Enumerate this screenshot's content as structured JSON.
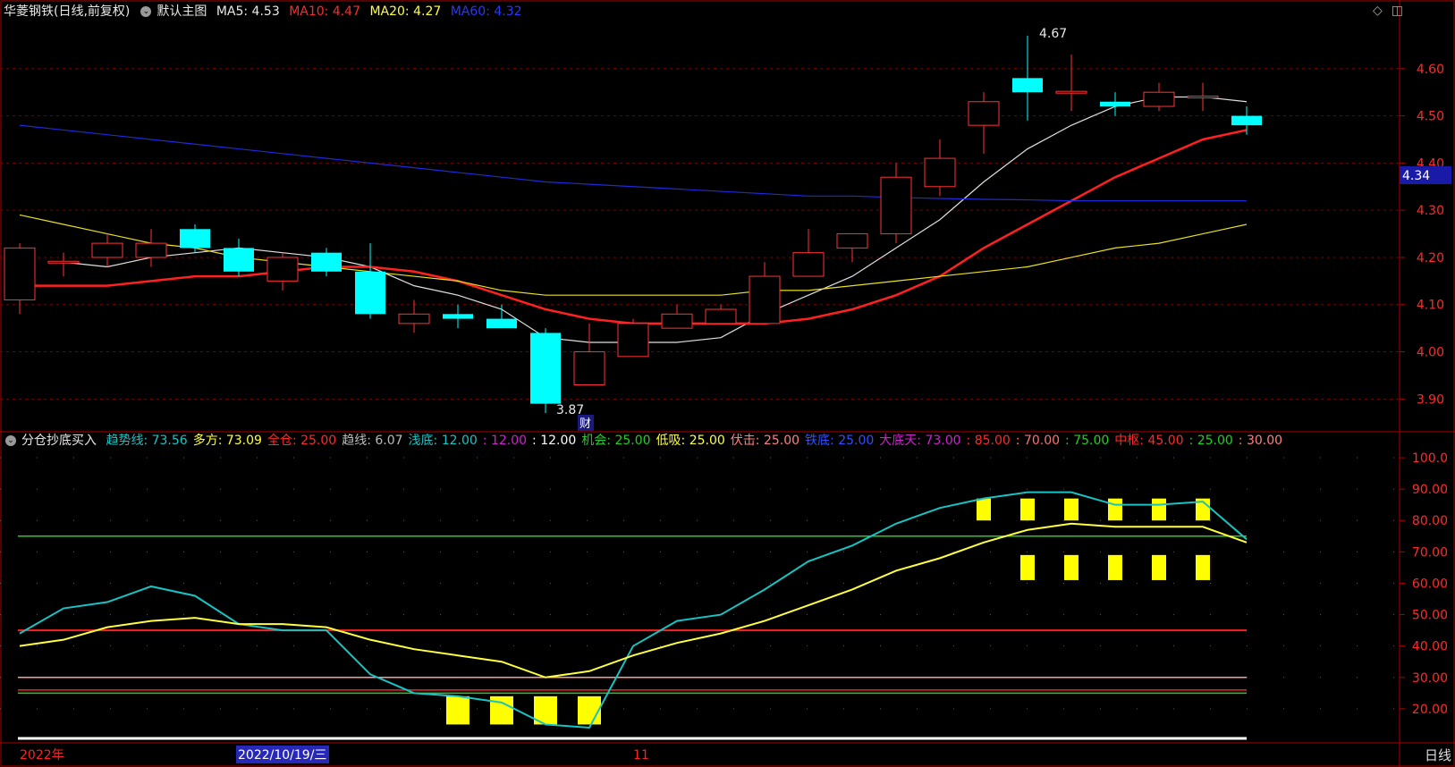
{
  "main_header": {
    "title": "华菱钢铁(日线,前复权)",
    "mode": "默认主图",
    "ma5": "MA5: 4.53",
    "ma10": "MA10: 4.47",
    "ma20": "MA20: 4.27",
    "ma60": "MA60: 4.32"
  },
  "indicator_header": {
    "name": "分仓抄底买入",
    "items": [
      {
        "text": "趋势线: 73.56",
        "color": "#19c3c3"
      },
      {
        "text": "多方: 73.09",
        "color": "#ffff40"
      },
      {
        "text": "全仓: 25.00",
        "color": "#ff2a2a"
      },
      {
        "text": "趋线: 6.07",
        "color": "#bbbbbb"
      },
      {
        "text": "浅底: 12.00",
        "color": "#19c3c3"
      },
      {
        "text": ": 12.00",
        "color": "#d020d0"
      },
      {
        "text": ": 12.00",
        "color": "#ffffff"
      },
      {
        "text": "机会: 25.00",
        "color": "#20d020"
      },
      {
        "text": "低吸: 25.00",
        "color": "#ffff40"
      },
      {
        "text": "伏击: 25.00",
        "color": "#ff8080"
      },
      {
        "text": "铁底: 25.00",
        "color": "#3050ff"
      },
      {
        "text": "大底天: 73.00",
        "color": "#d020d0"
      },
      {
        "text": ": 85.00",
        "color": "#ff2a2a"
      },
      {
        "text": ": 70.00",
        "color": "#ff7070"
      },
      {
        "text": ": 75.00",
        "color": "#20d020"
      },
      {
        "text": "中枢: 45.00",
        "color": "#ff2a2a"
      },
      {
        "text": ": 25.00",
        "color": "#20d020"
      },
      {
        "text": ": 30.00",
        "color": "#ff8080"
      }
    ]
  },
  "annotations": {
    "high": "4.67",
    "low": "3.87",
    "cai": "财"
  },
  "price_axis": {
    "labels": [
      "4.60",
      "4.50",
      "4.40",
      "4.30",
      "4.20",
      "4.10",
      "4.00",
      "3.90"
    ],
    "current": "4.34"
  },
  "indicator_axis": {
    "labels": [
      "100.0",
      "90.00",
      "80.00",
      "70.00",
      "60.00",
      "50.00",
      "40.00",
      "30.00",
      "20.00"
    ]
  },
  "bottom_axis": {
    "year": "2022年",
    "cursor_date": "2022/10/19/三",
    "month": "11",
    "timeframe": "日线"
  },
  "colors": {
    "up": "#ff3232",
    "down": "#00ffff",
    "grid": "#7a0000",
    "axis": "#b00000"
  },
  "chart_data": [
    {
      "type": "candlestick",
      "ylim": [
        3.84,
        4.7
      ],
      "candles": [
        {
          "o": 4.11,
          "h": 4.23,
          "l": 4.08,
          "c": 4.22
        },
        {
          "o": 4.19,
          "h": 4.21,
          "l": 4.16,
          "c": 4.19
        },
        {
          "o": 4.2,
          "h": 4.25,
          "l": 4.18,
          "c": 4.23
        },
        {
          "o": 4.2,
          "h": 4.26,
          "l": 4.18,
          "c": 4.23
        },
        {
          "o": 4.26,
          "h": 4.27,
          "l": 4.21,
          "c": 4.22
        },
        {
          "o": 4.22,
          "h": 4.24,
          "l": 4.16,
          "c": 4.17
        },
        {
          "o": 4.15,
          "h": 4.21,
          "l": 4.13,
          "c": 4.2
        },
        {
          "o": 4.21,
          "h": 4.22,
          "l": 4.16,
          "c": 4.17
        },
        {
          "o": 4.17,
          "h": 4.23,
          "l": 4.07,
          "c": 4.08
        },
        {
          "o": 4.06,
          "h": 4.11,
          "l": 4.04,
          "c": 4.08
        },
        {
          "o": 4.08,
          "h": 4.1,
          "l": 4.05,
          "c": 4.07
        },
        {
          "o": 4.07,
          "h": 4.1,
          "l": 4.05,
          "c": 4.05
        },
        {
          "o": 4.04,
          "h": 4.05,
          "l": 3.87,
          "c": 3.89
        },
        {
          "o": 3.93,
          "h": 4.06,
          "l": 3.93,
          "c": 4.0
        },
        {
          "o": 3.99,
          "h": 4.07,
          "l": 3.99,
          "c": 4.06
        },
        {
          "o": 4.05,
          "h": 4.1,
          "l": 4.05,
          "c": 4.08
        },
        {
          "o": 4.06,
          "h": 4.1,
          "l": 4.06,
          "c": 4.09
        },
        {
          "o": 4.06,
          "h": 4.19,
          "l": 4.06,
          "c": 4.16
        },
        {
          "o": 4.16,
          "h": 4.26,
          "l": 4.16,
          "c": 4.21
        },
        {
          "o": 4.22,
          "h": 4.25,
          "l": 4.19,
          "c": 4.25
        },
        {
          "o": 4.25,
          "h": 4.4,
          "l": 4.23,
          "c": 4.37
        },
        {
          "o": 4.35,
          "h": 4.45,
          "l": 4.33,
          "c": 4.41
        },
        {
          "o": 4.48,
          "h": 4.55,
          "l": 4.42,
          "c": 4.53
        },
        {
          "o": 4.58,
          "h": 4.67,
          "l": 4.49,
          "c": 4.55
        },
        {
          "o": 4.55,
          "h": 4.63,
          "l": 4.51,
          "c": 4.55
        },
        {
          "o": 4.53,
          "h": 4.55,
          "l": 4.5,
          "c": 4.52
        },
        {
          "o": 4.52,
          "h": 4.57,
          "l": 4.51,
          "c": 4.55
        },
        {
          "o": 4.54,
          "h": 4.57,
          "l": 4.51,
          "c": 4.54
        },
        {
          "o": 4.5,
          "h": 4.52,
          "l": 4.46,
          "c": 4.48
        }
      ],
      "series": [
        {
          "name": "MA5",
          "color": "#e0e0e0",
          "values": [
            null,
            4.19,
            4.18,
            4.2,
            4.21,
            4.22,
            4.21,
            4.2,
            4.18,
            4.14,
            4.12,
            4.09,
            4.03,
            4.02,
            4.02,
            4.02,
            4.03,
            4.08,
            4.12,
            4.16,
            4.22,
            4.28,
            4.36,
            4.43,
            4.48,
            4.52,
            4.54,
            4.54,
            4.53
          ]
        },
        {
          "name": "MA10",
          "color": "#ff2020",
          "values": [
            4.14,
            4.14,
            4.14,
            4.15,
            4.16,
            4.16,
            4.17,
            4.18,
            4.18,
            4.17,
            4.15,
            4.12,
            4.09,
            4.07,
            4.06,
            4.06,
            4.06,
            4.06,
            4.07,
            4.09,
            4.12,
            4.16,
            4.22,
            4.27,
            4.32,
            4.37,
            4.41,
            4.45,
            4.47
          ]
        },
        {
          "name": "MA20",
          "color": "#e8e020",
          "values": [
            4.29,
            4.27,
            4.25,
            4.23,
            4.22,
            4.2,
            4.19,
            4.18,
            4.17,
            4.16,
            4.15,
            4.13,
            4.12,
            4.12,
            4.12,
            4.12,
            4.12,
            4.13,
            4.13,
            4.14,
            4.15,
            4.16,
            4.17,
            4.18,
            4.2,
            4.22,
            4.23,
            4.25,
            4.27
          ]
        },
        {
          "name": "MA60",
          "color": "#1e2ad8",
          "values": [
            4.48,
            4.47,
            4.46,
            4.45,
            4.44,
            4.43,
            4.42,
            4.41,
            4.4,
            4.39,
            4.38,
            4.37,
            4.36,
            4.355,
            4.35,
            4.345,
            4.34,
            4.335,
            4.33,
            4.33,
            4.327,
            4.325,
            4.323,
            4.322,
            4.32,
            4.32,
            4.32,
            4.32,
            4.32
          ]
        }
      ]
    },
    {
      "type": "line",
      "ylim": [
        10,
        102
      ],
      "series": [
        {
          "name": "趋势线",
          "color": "#19c3c3",
          "values": [
            44,
            52,
            54,
            59,
            56,
            47,
            45,
            45,
            31,
            25,
            24,
            22,
            15,
            14,
            40,
            48,
            50,
            58,
            67,
            72,
            79,
            84,
            87,
            89,
            89,
            85,
            85,
            86,
            74
          ]
        },
        {
          "name": "多方",
          "color": "#ffff40",
          "values": [
            40,
            42,
            46,
            48,
            49,
            47,
            47,
            46,
            42,
            39,
            37,
            35,
            30,
            32,
            37,
            41,
            44,
            48,
            53,
            58,
            64,
            68,
            73,
            77,
            79,
            78,
            78,
            78,
            73
          ]
        }
      ],
      "levels": [
        {
          "value": 75,
          "color": "#20d020"
        },
        {
          "value": 45,
          "color": "#ff2020"
        },
        {
          "value": 30,
          "color": "#ff9a9a"
        },
        {
          "value": 25,
          "color": "#20d020"
        },
        {
          "value": 26,
          "color": "#ff2020"
        }
      ],
      "bars": [
        {
          "i": 10,
          "from": 15,
          "to": 24
        },
        {
          "i": 11,
          "from": 15,
          "to": 24
        },
        {
          "i": 12,
          "from": 15,
          "to": 24
        },
        {
          "i": 13,
          "from": 15,
          "to": 24
        },
        {
          "i": 22,
          "from": 80,
          "to": 87
        },
        {
          "i": 23,
          "from": 80,
          "to": 87
        },
        {
          "i": 24,
          "from": 80,
          "to": 87
        },
        {
          "i": 25,
          "from": 80,
          "to": 87
        },
        {
          "i": 26,
          "from": 80,
          "to": 87
        },
        {
          "i": 27,
          "from": 80,
          "to": 87
        },
        {
          "i": 23,
          "from": 61,
          "to": 69
        },
        {
          "i": 24,
          "from": 61,
          "to": 69
        },
        {
          "i": 25,
          "from": 61,
          "to": 69
        },
        {
          "i": 26,
          "from": 61,
          "to": 69
        },
        {
          "i": 27,
          "from": 61,
          "to": 69
        }
      ]
    }
  ]
}
